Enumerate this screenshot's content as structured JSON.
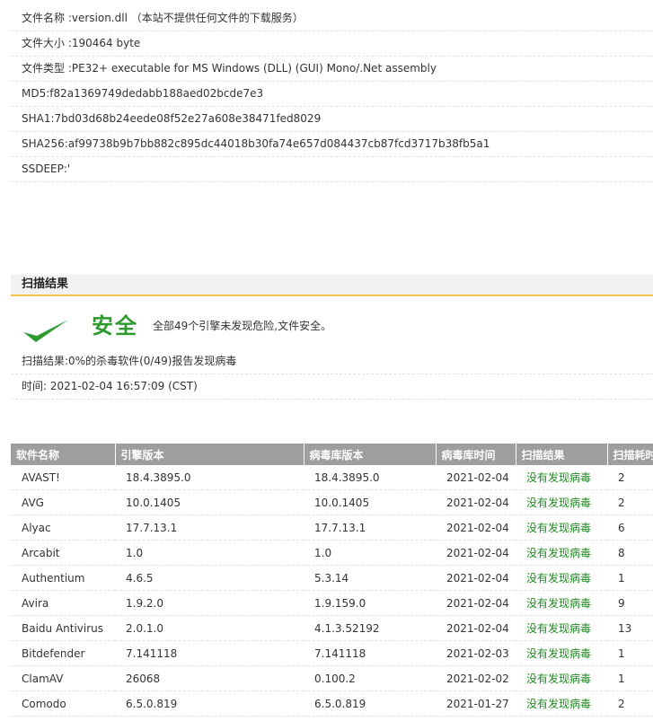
{
  "file_info": [
    {
      "label": "文件名称 :",
      "value": "version.dll （本站不提供任何文件的下载服务）"
    },
    {
      "label": "文件大小 :",
      "value": "190464 byte"
    },
    {
      "label": "文件类型 :",
      "value": "PE32+ executable for MS Windows (DLL) (GUI) Mono/.Net assembly"
    },
    {
      "label": "MD5:",
      "value": "f82a1369749dedabb188aed02bcde7e3"
    },
    {
      "label": "SHA1:",
      "value": "7bd03d68b24eede08f52e27a608e38471fed8029"
    },
    {
      "label": "SHA256:",
      "value": "af99738b9b7bb882c895dc44018b30fa74e657d084437cb87fcd3717b38fb5a1"
    },
    {
      "label": "SSDEEP:",
      "value": "'"
    }
  ],
  "scan_section": {
    "title": "扫描结果",
    "safe_label": "安全",
    "safe_description": "全部49个引擎未发现危险,文件安全。",
    "check_icon": "check-mark-icon",
    "safe_color": "#2e9a2e",
    "summary": "扫描结果:0%的杀毒软件(0/49)报告发现病毒",
    "time": "时间: 2021-02-04 16:57:09 (CST)"
  },
  "table": {
    "headers": [
      "软件名称",
      "引擎版本",
      "病毒库版本",
      "病毒库时间",
      "扫描结果",
      "扫描耗时"
    ],
    "rows": [
      [
        "AVAST!",
        "18.4.3895.0",
        "18.4.3895.0",
        "2021-02-04",
        "没有发现病毒",
        "2"
      ],
      [
        "AVG",
        "10.0.1405",
        "10.0.1405",
        "2021-02-04",
        "没有发现病毒",
        "2"
      ],
      [
        "Alyac",
        "17.7.13.1",
        "17.7.13.1",
        "2021-02-04",
        "没有发现病毒",
        "6"
      ],
      [
        "Arcabit",
        "1.0",
        "1.0",
        "2021-02-04",
        "没有发现病毒",
        "8"
      ],
      [
        "Authentium",
        "4.6.5",
        "5.3.14",
        "2021-02-04",
        "没有发现病毒",
        "1"
      ],
      [
        "Avira",
        "1.9.2.0",
        "1.9.159.0",
        "2021-02-04",
        "没有发现病毒",
        "9"
      ],
      [
        "Baidu Antivirus",
        "2.0.1.0",
        "4.1.3.52192",
        "2021-02-04",
        "没有发现病毒",
        "13"
      ],
      [
        "Bitdefender",
        "7.141118",
        "7.141118",
        "2021-02-03",
        "没有发现病毒",
        "1"
      ],
      [
        "ClamAV",
        "26068",
        "0.100.2",
        "2021-02-02",
        "没有发现病毒",
        "1"
      ],
      [
        "Comodo",
        "6.5.0.819",
        "6.5.0.819",
        "2021-01-27",
        "没有发现病毒",
        "2"
      ]
    ],
    "header_bg": "#9e9e9e",
    "result_color": "#1f8a1f"
  }
}
